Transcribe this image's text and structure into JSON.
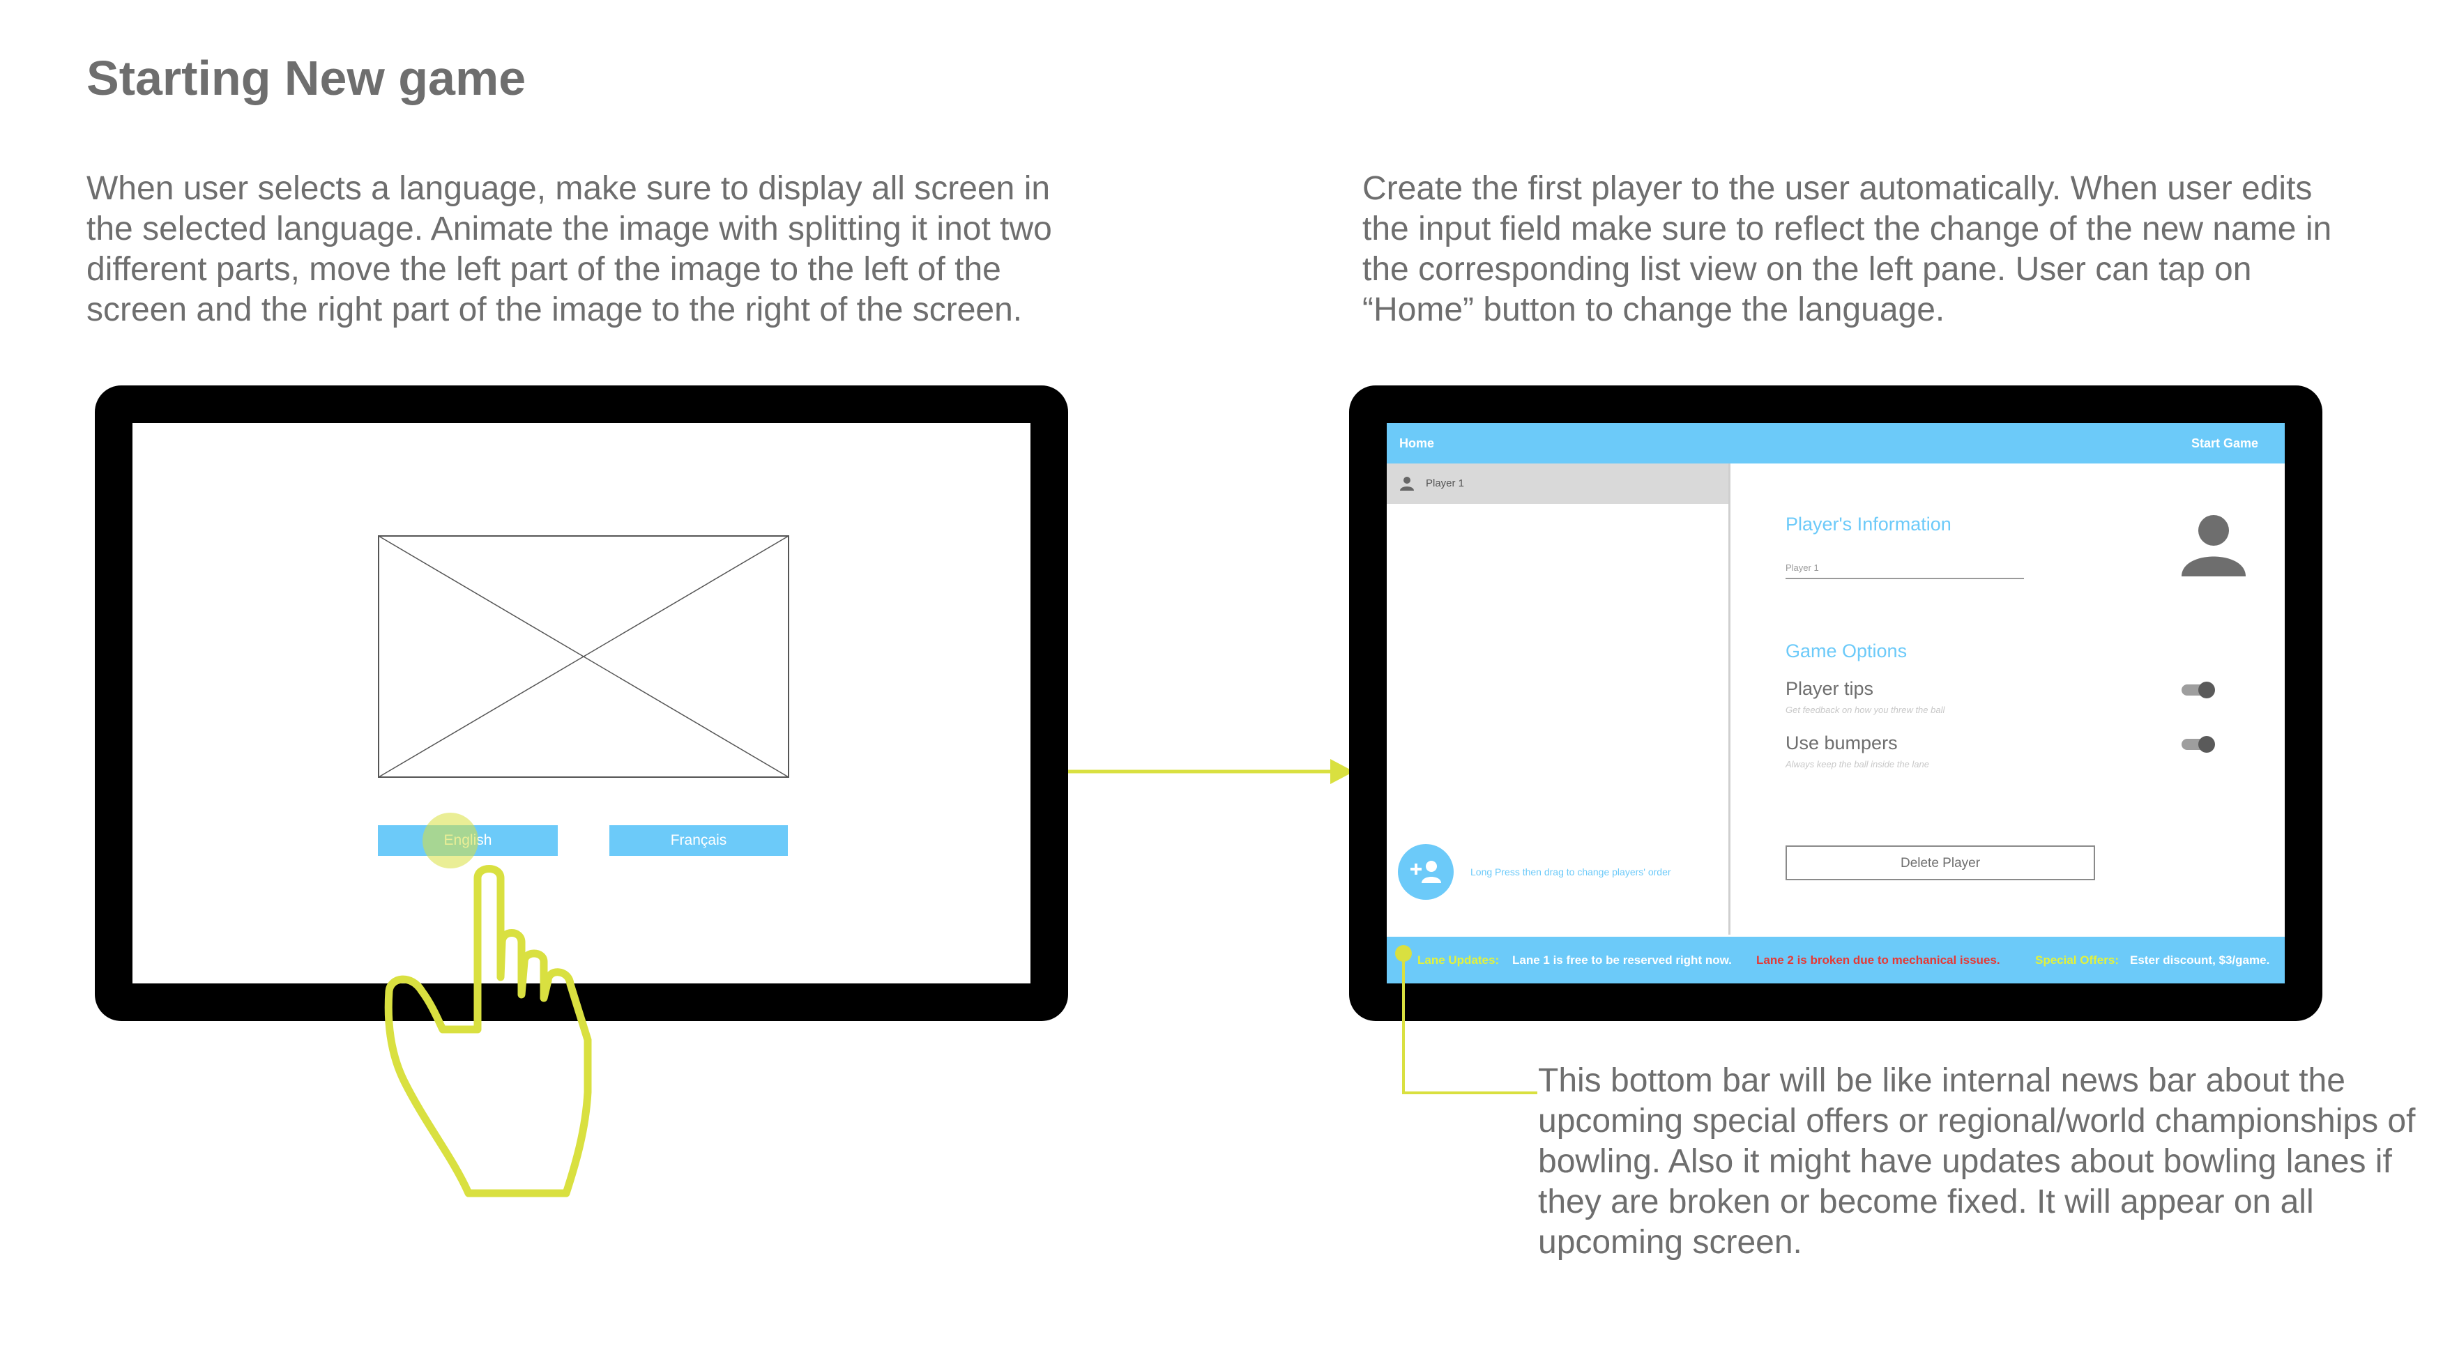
{
  "title": "Starting New game",
  "descriptions": {
    "left": "When user selects a language, make sure to display all screen in the selected language. Animate the image with splitting it inot two different parts, move the left part of the image to the left of the screen and the right part of the image to the right of the screen.",
    "right": "Create the first player to the user automatically. When user edits the input field make sure  to reflect the change of the new name in the corresponding list view on the left pane. User can tap on “Home” button to change the language.",
    "bottom": "This bottom bar will be like internal news bar about the upcoming special offers or regional/world championships of bowling. Also it might have updates about bowling lanes if they are broken or become fixed. It will appear on all upcoming screen."
  },
  "language_screen": {
    "english_label": "English",
    "francais_label": "Français"
  },
  "player_screen": {
    "home_label": "Home",
    "start_game_label": "Start Game",
    "player_list": [
      {
        "name": "Player 1"
      }
    ],
    "reorder_hint": "Long Press then drag to change players' order",
    "player_info_title": "Player's  Information",
    "player_name_value": "Player 1",
    "game_options_title": "Game  Options",
    "options": [
      {
        "label": "Player  tips",
        "sub": "Get feedback on how you threw the ball",
        "on": true
      },
      {
        "label": "Use  bumpers",
        "sub": "Always keep the ball inside the lane",
        "on": true
      }
    ],
    "delete_label": "Delete  Player"
  },
  "news_bar": {
    "lane_label": "Lane Updates:",
    "lane1": "Lane 1 is free to be reserved right now.",
    "lane2": "Lane 2 is broken due to mechanical issues.",
    "offers_label": "Special Offers:",
    "offers": "Ester  discount, $3/game."
  },
  "colors": {
    "accent": "#6ccaf9",
    "annotation": "#d9e040",
    "alert": "#e53935",
    "text": "#6e6e6e"
  }
}
